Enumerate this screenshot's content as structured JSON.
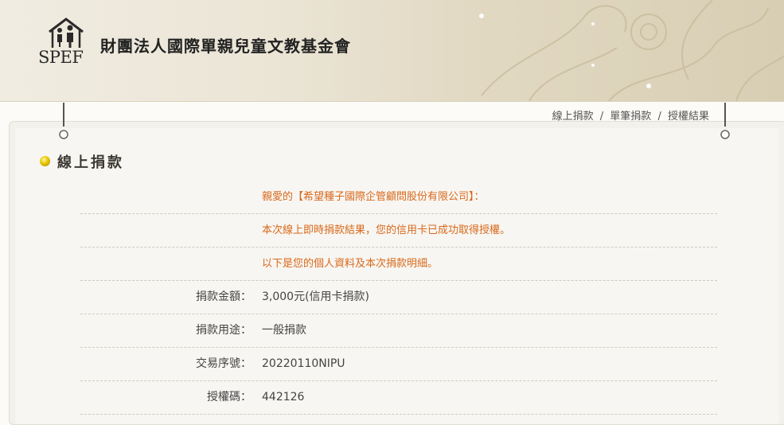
{
  "header": {
    "logo_text": "SPEF",
    "org_name": "財團法人國際單親兒童文教基金會"
  },
  "breadcrumb": {
    "items": [
      "線上捐款",
      "單筆捐款",
      "授權結果"
    ],
    "separator": "/"
  },
  "section": {
    "title": "線上捐款"
  },
  "messages": [
    "親愛的【希望種子國際企管顧問股份有限公司】：",
    "本次線上即時捐款結果，您的信用卡已成功取得授權。",
    "以下是您的個人資料及本次捐款明細。"
  ],
  "details": [
    {
      "label": "捐款金額：",
      "value": "3,000元(信用卡捐款)"
    },
    {
      "label": "捐款用途：",
      "value": "一般捐款"
    },
    {
      "label": "交易序號：",
      "value": "20220110NIPU"
    },
    {
      "label": "授權碼：",
      "value": "442126"
    }
  ],
  "colors": {
    "accent": "#d9681a",
    "text": "#444444"
  }
}
